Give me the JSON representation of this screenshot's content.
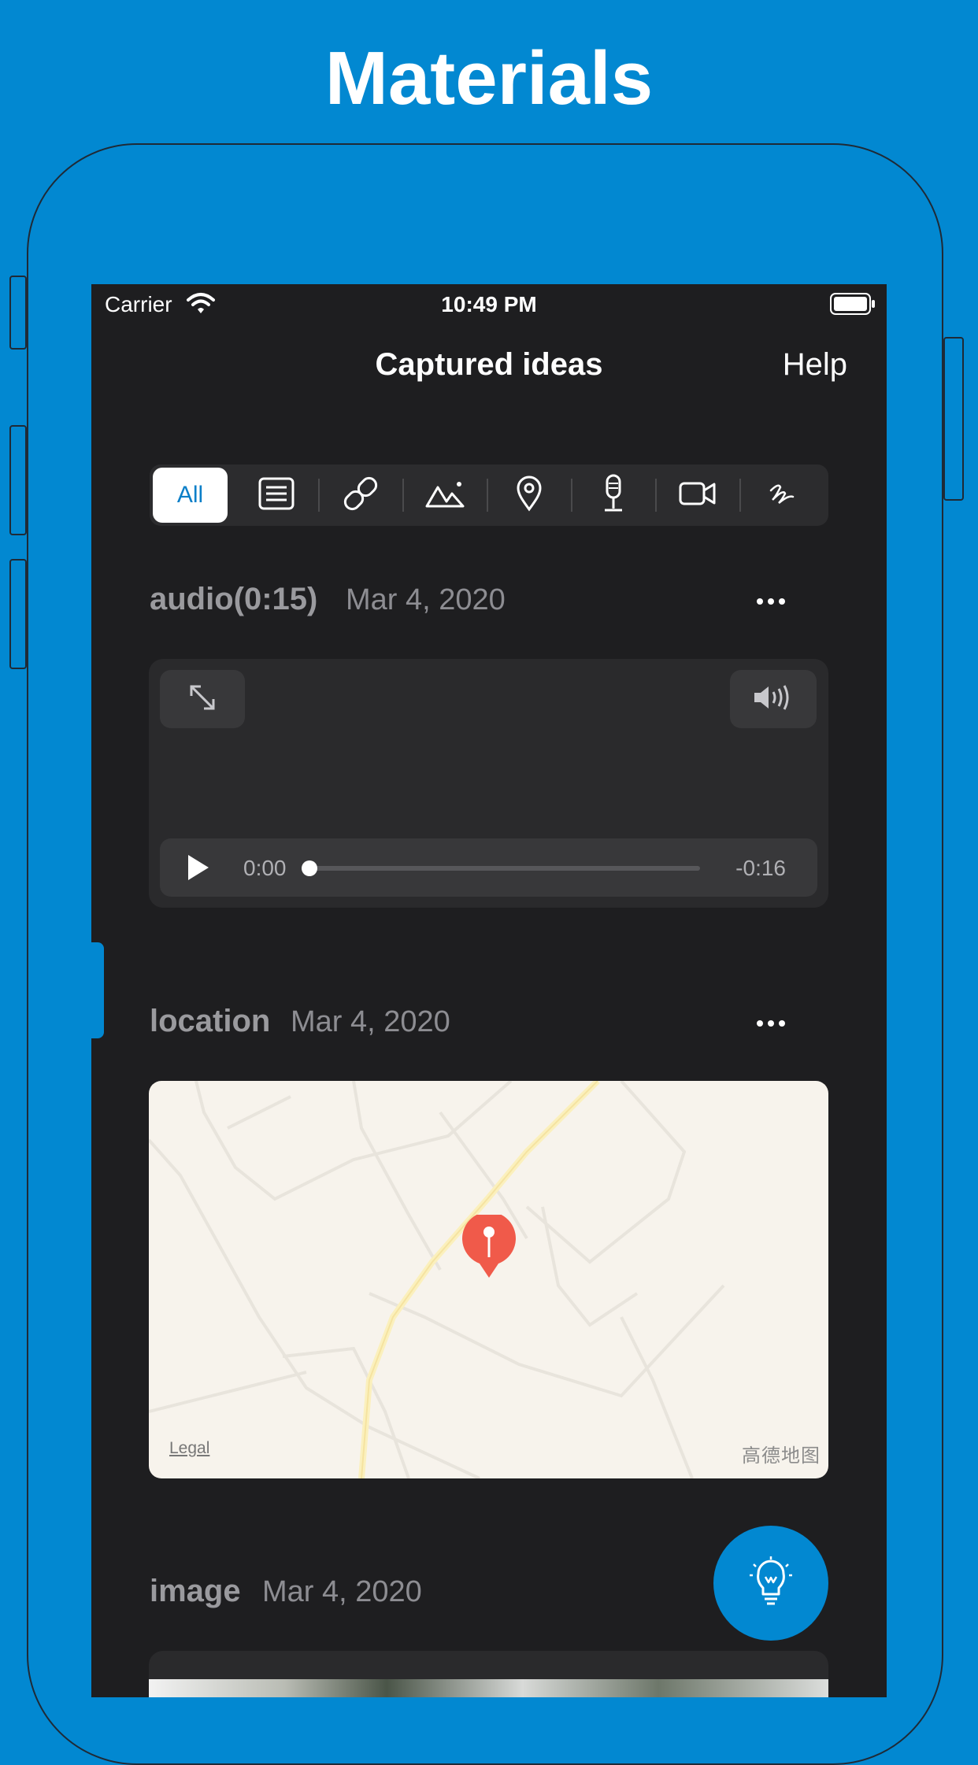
{
  "headline": "Materials",
  "status_bar": {
    "carrier": "Carrier",
    "time": "10:49 PM"
  },
  "nav": {
    "title": "Captured ideas",
    "help_label": "Help"
  },
  "filters": {
    "selected": "All",
    "all_label": "All",
    "icons": [
      "text-icon",
      "link-icon",
      "image-icon",
      "location-icon",
      "microphone-icon",
      "video-icon",
      "sketch-icon"
    ]
  },
  "entries": [
    {
      "type_label": "audio(0:15)",
      "date": "Mar 4, 2020",
      "player": {
        "current": "0:00",
        "remaining": "-0:16",
        "progress": 0.0
      }
    },
    {
      "type_label": "location",
      "date": "Mar 4, 2020",
      "map": {
        "legal_label": "Legal",
        "attribution": "高德地图"
      }
    },
    {
      "type_label": "image",
      "date": "Mar 4, 2020"
    }
  ],
  "colors": {
    "background": "#0288d1",
    "screen": "#1e1e20",
    "accent": "#0b7fc8",
    "pin": "#f05a4a"
  }
}
